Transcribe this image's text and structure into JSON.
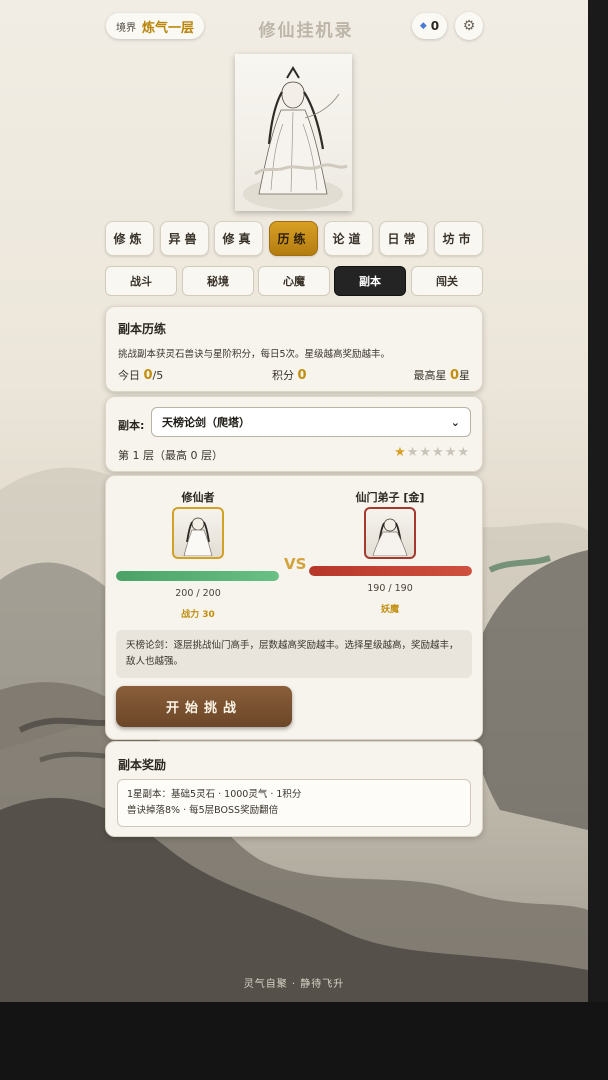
{
  "header": {
    "realm_label": "境界",
    "realm_value": "炼气一层",
    "title": "修仙挂机录",
    "currency_value": "0",
    "gem_icon": "diamond-icon",
    "settings_icon": "gear-icon"
  },
  "main_tabs": [
    {
      "label": "修炼",
      "active": false
    },
    {
      "label": "异兽",
      "active": false
    },
    {
      "label": "修真",
      "active": false
    },
    {
      "label": "历练",
      "active": true
    },
    {
      "label": "论道",
      "active": false
    },
    {
      "label": "日常",
      "active": false
    },
    {
      "label": "坊市",
      "active": false
    }
  ],
  "sub_tabs": [
    {
      "label": "战斗",
      "active": false
    },
    {
      "label": "秘境",
      "active": false
    },
    {
      "label": "心魔",
      "active": false
    },
    {
      "label": "副本",
      "active": true
    },
    {
      "label": "闯关",
      "active": false
    }
  ],
  "dungeon_info": {
    "title": "副本历练",
    "description": "挑战副本获灵石兽诀与星阶积分，每日5次。星级越高奖励越丰。",
    "today_label": "今日",
    "today_value": "0",
    "today_max": "/5",
    "points_label": "积分",
    "points_value": "0",
    "best_star_label": "最高星",
    "best_star_value": "0",
    "best_star_unit": "星"
  },
  "dungeon_select": {
    "label": "副本:",
    "selected": "天榜论剑（爬塔）",
    "floor_text": "第 1 层（最高 0 层）",
    "stars_filled": 1,
    "stars_total": 6
  },
  "battle": {
    "player_name": "修仙者",
    "player_hp_current": 200,
    "player_hp_max": 200,
    "player_hp_text": "200 / 200",
    "player_power": "战力 30",
    "vs": "VS",
    "enemy_name": "仙门弟子 [金]",
    "enemy_hp_current": 190,
    "enemy_hp_max": 190,
    "enemy_hp_text": "190 / 190",
    "enemy_type": "妖魔",
    "description": "天榜论剑：逐层挑战仙门高手，层数越高奖励越丰。选择星级越高，奖励越丰，敌人也越强。",
    "start_button": "开始挑战"
  },
  "rewards": {
    "title": "副本奖励",
    "line1": "1星副本：基础5灵石 · 1000灵气 · 1积分",
    "line2": "兽诀掉落8% · 每5层BOSS奖励翻倍"
  },
  "footer": {
    "text": "灵气自聚 · 静待飞升"
  }
}
